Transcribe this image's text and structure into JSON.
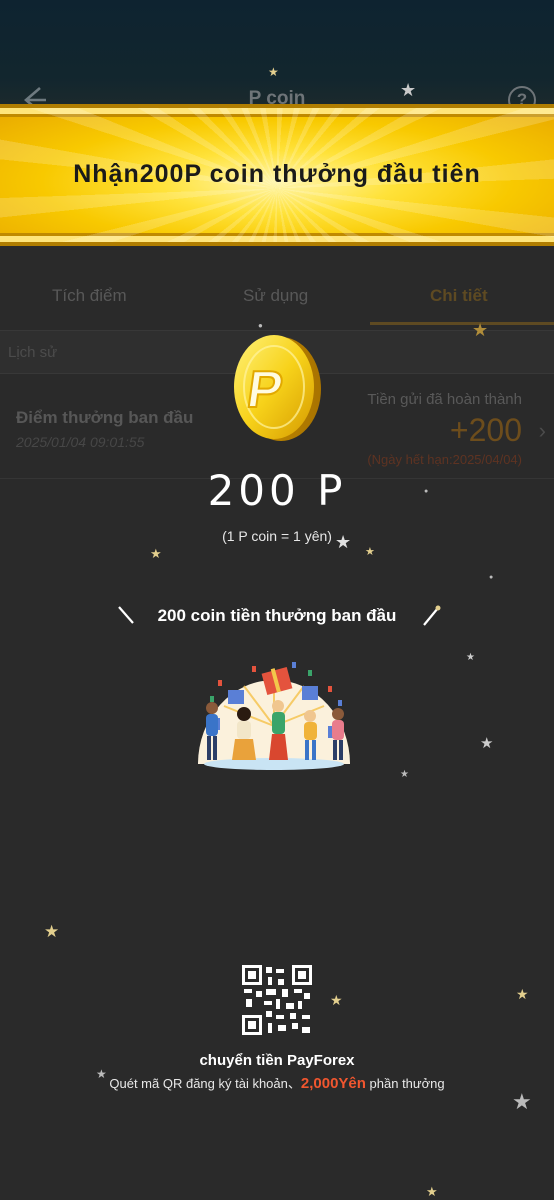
{
  "nav": {
    "back_icon": "arrow-left-icon",
    "title": "P coin",
    "help_icon": "question-circle-icon"
  },
  "banner": {
    "text": "Nhận200P coin thưởng đầu tiên"
  },
  "tabs": [
    {
      "label": "Tích điểm"
    },
    {
      "label": "Sử dụng"
    },
    {
      "label": "Chi tiết"
    }
  ],
  "history": {
    "label": "Lịch sử"
  },
  "record": {
    "title": "Điểm thưởng ban đầu",
    "date": "2025/01/04 09:01:55",
    "status": "Tiền gửi đã hoàn thành",
    "amount": "+200",
    "expire": "(Ngày hết hạn:2025/04/04)"
  },
  "reward": {
    "coin_letter": "P",
    "amount": "200 P",
    "rate": "(1 P coin = 1 yên)",
    "bonus_text": "200 coin tiền thưởng ban đầu"
  },
  "promo": {
    "title": "chuyển tiền PayForex",
    "sub_before": "Quét mã QR đăng ký tài khoản、",
    "sub_highlight": "2,000Yên",
    "sub_after": " phần thưởng"
  },
  "colors": {
    "gold": "#f8c900",
    "accent_orange": "#f0562f",
    "background": "#2a2a2a"
  }
}
